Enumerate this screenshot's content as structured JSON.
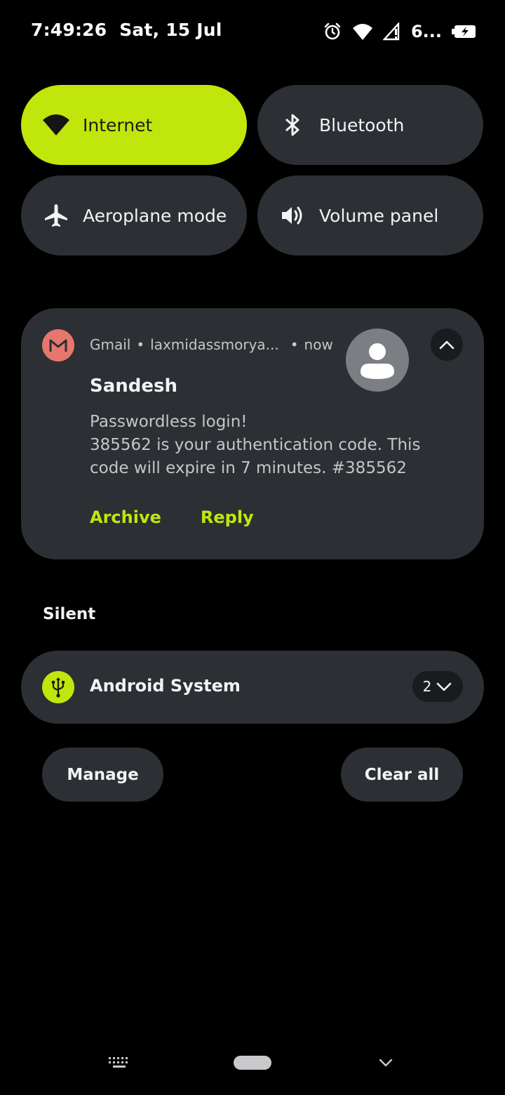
{
  "status_bar": {
    "time": "7:49:26",
    "date": "Sat, 15 Jul",
    "battery_text": "6...",
    "icons": [
      "alarm-icon",
      "wifi-icon",
      "signal-icon",
      "battery-charging-icon"
    ]
  },
  "quick_tiles": [
    {
      "label": "Internet",
      "icon": "wifi-icon",
      "active": true
    },
    {
      "label": "Bluetooth",
      "icon": "bluetooth-icon",
      "active": false
    },
    {
      "label": "Aeroplane mode",
      "icon": "airplane-icon",
      "active": false
    },
    {
      "label": "Volume panel",
      "icon": "volume-icon",
      "active": false
    }
  ],
  "notification": {
    "app": "Gmail",
    "account": "laxmidassmorya...",
    "time": "now",
    "title": "Sandesh",
    "body_lines": [
      "Passwordless login!",
      "385562 is your authentication code. This",
      "code will expire in 7 minutes. #385562"
    ],
    "actions": [
      "Archive",
      "Reply"
    ],
    "separator": "•"
  },
  "silent": {
    "header": "Silent",
    "item_title": "Android System",
    "count": "2"
  },
  "buttons": {
    "manage": "Manage",
    "clear_all": "Clear all"
  },
  "colors": {
    "accent": "#c1e60c",
    "tile_bg": "#2c2f33",
    "gmail_icon_bg": "#e5776e"
  }
}
